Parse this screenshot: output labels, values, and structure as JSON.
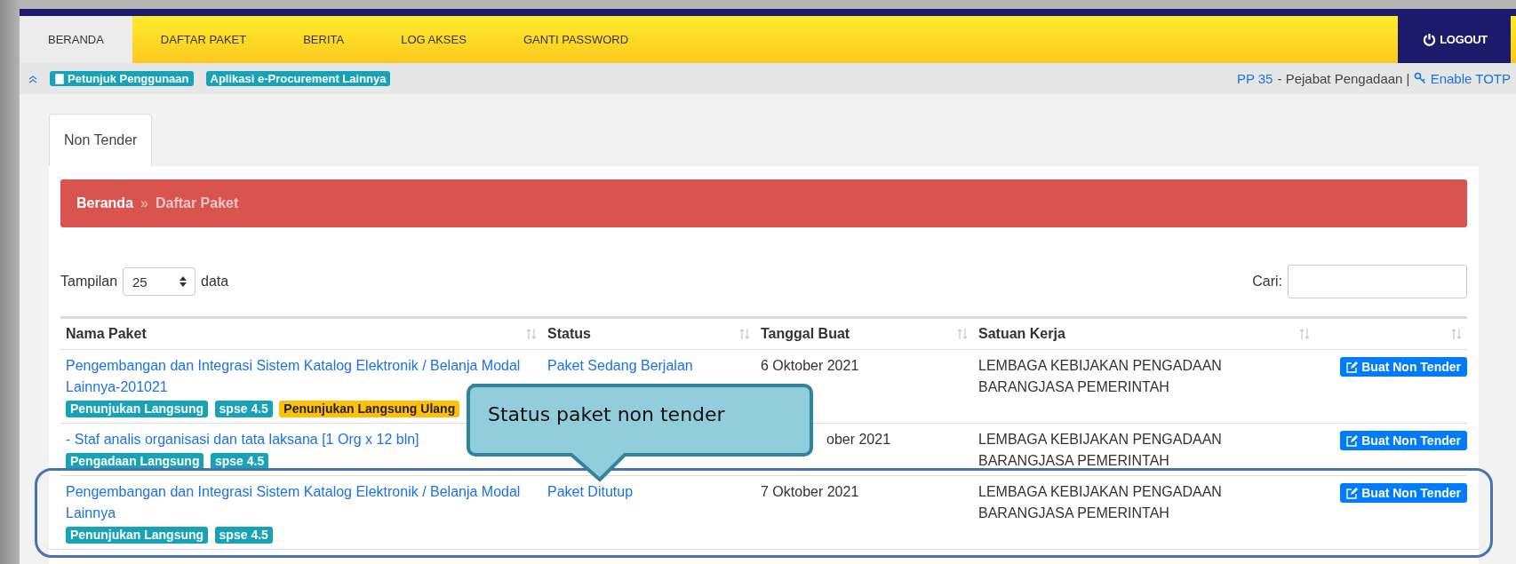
{
  "nav": {
    "tabs": [
      {
        "label": "BERANDA",
        "selected": true
      },
      {
        "label": "DAFTAR PAKET",
        "selected": false
      },
      {
        "label": "BERITA",
        "selected": false
      },
      {
        "label": "LOG AKSES",
        "selected": false
      },
      {
        "label": "GANTI PASSWORD",
        "selected": false
      }
    ],
    "logout": "LOGOUT"
  },
  "subbar": {
    "links": [
      "Petunjuk Penggunaan",
      "Aplikasi e-Procurement Lainnya"
    ],
    "user_code": "PP 35",
    "role": "- Pejabat Pengadaan |",
    "totp": "Enable TOTP"
  },
  "page_tabs": [
    {
      "label": "Non Tender",
      "selected": true
    }
  ],
  "breadcrumb": {
    "home": "Beranda",
    "separator": "»",
    "current": "Daftar Paket"
  },
  "length_menu": {
    "label": "Tampilan",
    "value": "25",
    "suffix": "data"
  },
  "search": {
    "label": "Cari:"
  },
  "table": {
    "columns": [
      "Nama Paket",
      "Status",
      "Tanggal Buat",
      "Satuan Kerja"
    ],
    "rows": [
      {
        "name": "Pengembangan dan Integrasi Sistem Katalog Elektronik / Belanja Modal Lainnya-201021",
        "badges": [
          {
            "text": "Penunjukan Langsung",
            "kind": "method"
          },
          {
            "text": "spse 4.5",
            "kind": "version"
          },
          {
            "text": "Penunjukan Langsung Ulang",
            "kind": "repeat"
          }
        ],
        "status": "Paket Sedang Berjalan",
        "date": "6 Oktober 2021",
        "unit": "LEMBAGA KEBIJAKAN PENGADAAN BARANGJASA PEMERINTAH",
        "action": "Buat Non Tender",
        "highlighted": false
      },
      {
        "name": "- Staf analis organisasi dan tata laksana [1 Org x 12 bln]",
        "badges": [
          {
            "text": "Pengadaan Langsung",
            "kind": "method"
          },
          {
            "text": "spse 4.5",
            "kind": "version"
          }
        ],
        "date": "ober 2021",
        "unit": "LEMBAGA KEBIJAKAN PENGADAAN BARANGJASA PEMERINTAH",
        "action": "Buat Non Tender",
        "highlighted": false
      },
      {
        "name": "Pengembangan dan Integrasi Sistem Katalog Elektronik / Belanja Modal Lainnya",
        "badges": [
          {
            "text": "Penunjukan Langsung",
            "kind": "method"
          },
          {
            "text": "spse 4.5",
            "kind": "version"
          }
        ],
        "status": "Paket Ditutup",
        "date": "7 Oktober 2021",
        "unit": "LEMBAGA KEBIJAKAN PENGADAAN BARANGJASA PEMERINTAH",
        "action": "Buat Non Tender",
        "highlighted": true
      }
    ]
  },
  "callout": {
    "text": "Status paket non tender"
  }
}
